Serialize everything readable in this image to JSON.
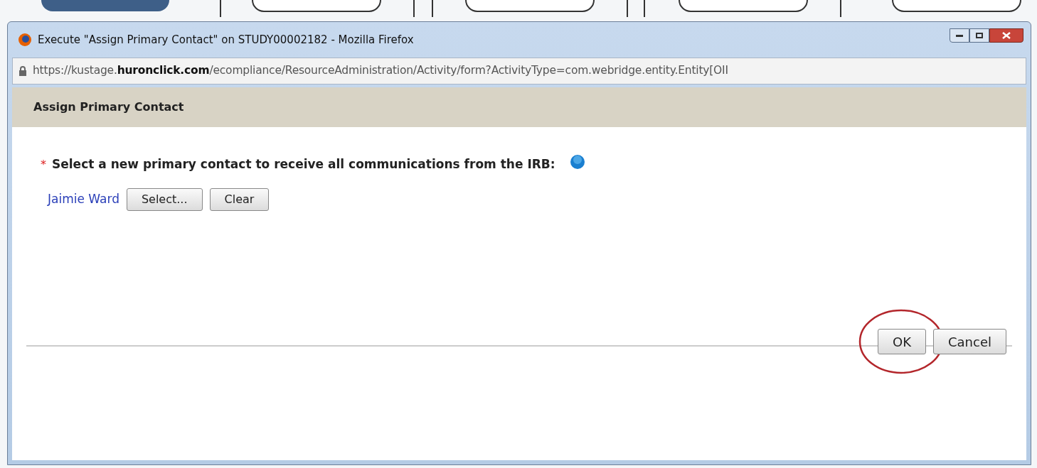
{
  "window": {
    "title": "Execute \"Assign Primary Contact\" on STUDY00002182 - Mozilla Firefox"
  },
  "address_bar": {
    "url_prefix": "https://kustage.",
    "url_domain": "huronclick.com",
    "url_path": "/ecompliance/ResourceAdministration/Activity/form?ActivityType=com.webridge.entity.Entity[OII"
  },
  "form": {
    "title": "Assign Primary Contact",
    "required_mark": "*",
    "question": "Select a new primary contact to receive all communications from the IRB:",
    "contact": "Jaimie Ward",
    "field_buttons": [
      "Select...",
      "Clear"
    ]
  },
  "buttons": [
    {
      "label": "OK",
      "highlighted": true
    },
    {
      "label": "Cancel",
      "highlighted": false
    }
  ]
}
